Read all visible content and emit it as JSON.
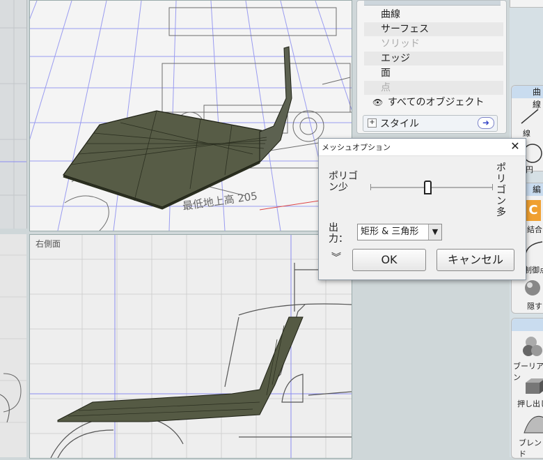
{
  "menu": {
    "items": [
      {
        "label": "曲線",
        "disabled": false
      },
      {
        "label": "サーフェス",
        "disabled": false
      },
      {
        "label": "ソリッド",
        "disabled": true
      },
      {
        "label": "エッジ",
        "disabled": false
      },
      {
        "label": "面",
        "disabled": false
      },
      {
        "label": "点",
        "disabled": true
      }
    ],
    "all_objects": "すべてのオブジェクト",
    "style": "スタイル"
  },
  "viewport": {
    "right_title": "右側面"
  },
  "dimension_text": "最低地上高 205",
  "tools": {
    "curve_head": "曲線",
    "line_label": "線",
    "circle_label": "円",
    "edit_head": "編",
    "combine_label": "結合",
    "points_label": "制御点",
    "hide_label": "隠す",
    "boolean_label": "ブーリアン",
    "extrude_label": "押し出し",
    "blend_label": "ブレンド"
  },
  "dialog": {
    "title": "メッシュオプション",
    "poly_low": "ポリゴン少",
    "poly_high": "ポリゴン多",
    "slider_value": 0.47,
    "output_label": "出力：",
    "output_value": "矩形 & 三角形",
    "ok": "OK",
    "cancel": "キャンセル"
  },
  "colors": {
    "grid_blue": "#8a8cf0",
    "surface": "#565b46",
    "dialog_bg": "#f0f0f0"
  }
}
